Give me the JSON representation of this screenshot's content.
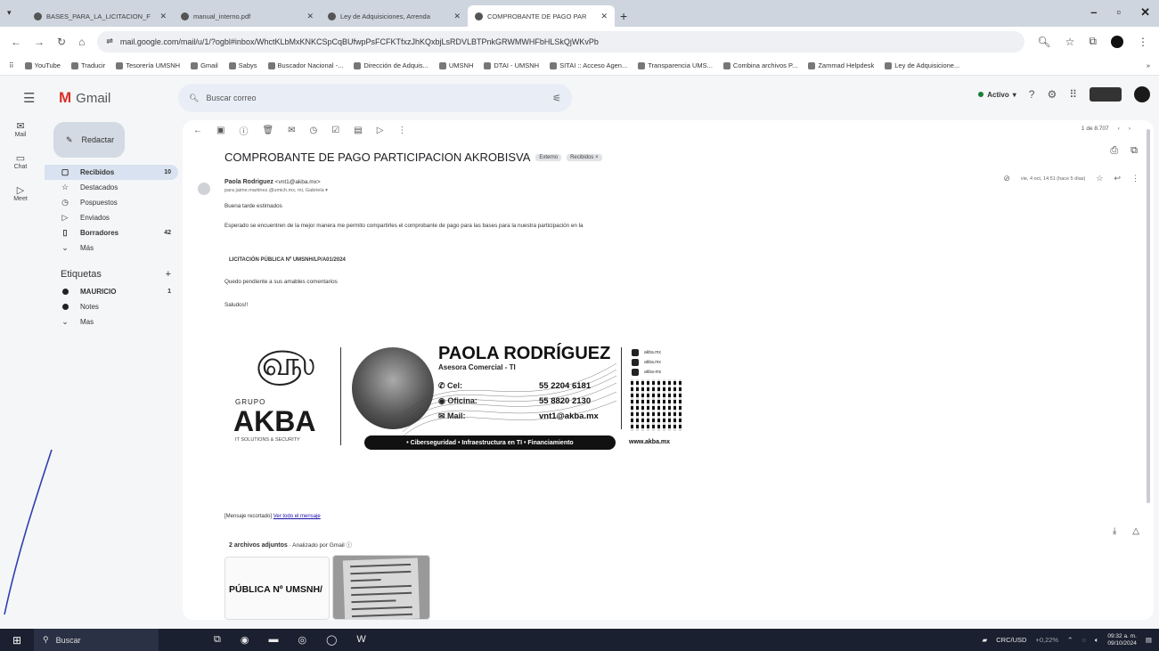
{
  "browser": {
    "tabs": [
      {
        "title": "BASES_PARA_LA_LICITACION_F",
        "active": false
      },
      {
        "title": "manual_interno.pdf",
        "active": false
      },
      {
        "title": "Ley de Adquisiciones, Arrenda",
        "active": false
      },
      {
        "title": "COMPROBANTE DE PAGO PAR",
        "active": true
      }
    ],
    "url": "mail.google.com/mail/u/1/?ogbl#inbox/WhctKLbMxKNKCSpCqBUfwpPsFCFKTfxzJhKQxbjLsRDVLBTPnkGRWMWHFbHLSkQjWKvPb",
    "bookmarks": [
      "YouTube",
      "Traducir",
      "Tesorería UMSNH",
      "Gmail",
      "Sabys",
      "Buscador Nacional -...",
      "Dirección de Adquis...",
      "UMSNH",
      "DTAI - UMSNH",
      "SITAI :: Acceso Agen...",
      "Transparencia UMS...",
      "Combina archivos P...",
      "Zammad Helpdesk",
      "Ley de Adquisicione..."
    ]
  },
  "gmail": {
    "app_name": "Gmail",
    "search_placeholder": "Buscar correo",
    "status": "Activo",
    "compose": "Redactar",
    "rail": [
      {
        "label": "Mail"
      },
      {
        "label": "Chat"
      },
      {
        "label": "Meet"
      }
    ],
    "nav": [
      {
        "label": "Recibidos",
        "count": "10",
        "selected": true,
        "bold": true
      },
      {
        "label": "Destacados",
        "count": "",
        "bold": false
      },
      {
        "label": "Pospuestos",
        "count": "",
        "bold": false
      },
      {
        "label": "Enviados",
        "count": "",
        "bold": false
      },
      {
        "label": "Borradores",
        "count": "42",
        "bold": true
      },
      {
        "label": "Más",
        "count": "",
        "bold": false
      }
    ],
    "labels_title": "Etiquetas",
    "labels": [
      {
        "label": "MAURICIO",
        "count": "1",
        "bold": true
      },
      {
        "label": "Notes",
        "count": "",
        "bold": false
      },
      {
        "label": "Mas",
        "count": "",
        "bold": false
      }
    ]
  },
  "email": {
    "pager": "1 de 8.707",
    "subject": "COMPROBANTE DE PAGO PARTICIPACION AKROBISVA",
    "chips": [
      "Externo",
      "Recibidos ×"
    ],
    "sender_name": "Paola Rodriguez",
    "sender_email": "<vnt1@akba.mx>",
    "recipient": "para jaime.martinez.@umich.mx, mi, Gabriela ▾",
    "date": "vie, 4 oct, 14:51 (hace 5 días)",
    "body": [
      "Buena tarde estimados",
      "Esperado se encuentren de la mejor manera me permito compartirles el comprobante de pago para las bases para la nuestra participación en la",
      "LICITACIÓN PÚBLICA Nº UMSNH/LP/A01/2024",
      "Quedo pendiente a sus amables comentarios",
      "Saludos!!"
    ],
    "clipped_prefix": "[Mensaje recortado] ",
    "clipped_link": "Ver todo el mensaje",
    "attachments_title": "2 archivos adjuntos",
    "attachments_scan": " · Analizado por Gmail ⓘ",
    "attachment1_text": "PÚBLICA Nº UMSNH/"
  },
  "signature": {
    "group": "GRUPO",
    "brand": "AKBA",
    "tagline": "IT SOLUTIONS & SECURITY",
    "name": "PAOLA RODRÍGUEZ",
    "role": "Asesora Comercial - TI",
    "cel_label": "Cel:",
    "cel": "55 2204 6181",
    "office_label": "Oficina:",
    "office": "55 8820 2130",
    "mail_label": "Mail:",
    "mail": "vnt1@akba.mx",
    "socials": [
      "akba.mx",
      "akba.mx",
      "akba-mx"
    ],
    "website": "www.akba.mx",
    "services": "• Ciberseguridad • Infraestructura en TI • Financiamiento"
  },
  "taskbar": {
    "search": "Buscar",
    "currency": "CRC/USD",
    "currency_change": "+0,22%",
    "time": "09:32 a. m.",
    "date": "09/10/2024"
  }
}
